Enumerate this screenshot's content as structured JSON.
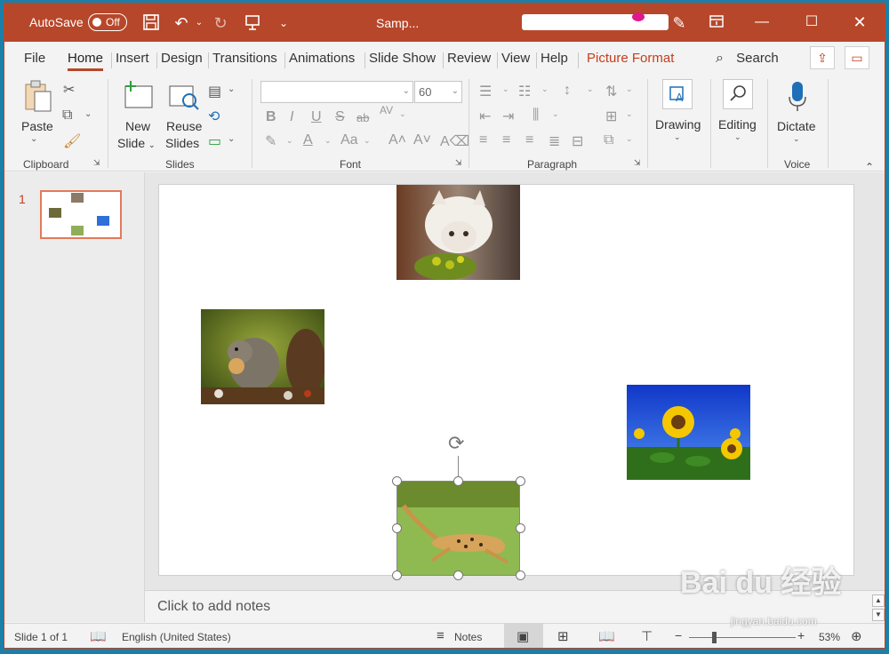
{
  "window": {
    "autosave_label": "AutoSave",
    "autosave_state": "Off",
    "doc_title": "Samp..."
  },
  "tabs": [
    {
      "label": "File"
    },
    {
      "label": "Home"
    },
    {
      "label": "Insert"
    },
    {
      "label": "Design"
    },
    {
      "label": "Transitions"
    },
    {
      "label": "Animations"
    },
    {
      "label": "Slide Show"
    },
    {
      "label": "Review"
    },
    {
      "label": "View"
    },
    {
      "label": "Help"
    },
    {
      "label": "Picture Format"
    }
  ],
  "search_label": "Search",
  "ribbon": {
    "paste": "Paste",
    "new_slide": "New",
    "new_slide_2": "Slide",
    "reuse": "Reuse",
    "reuse_2": "Slides",
    "font_size": "60",
    "drawing": "Drawing",
    "editing": "Editing",
    "dictate": "Dictate",
    "groups": {
      "clipboard": "Clipboard",
      "slides": "Slides",
      "font": "Font",
      "paragraph": "Paragraph",
      "voice": "Voice"
    }
  },
  "thumbnail_number": "1",
  "notes_placeholder": "Click to add notes",
  "status": {
    "slide_info": "Slide 1 of 1",
    "language": "English (United States)",
    "notes_label": "Notes",
    "zoom_minus": "−",
    "zoom_plus": "+",
    "zoom_value": "53%"
  },
  "watermark": {
    "main": "Bai du 经验",
    "sub": "jingyan.baidu.com"
  },
  "colors": {
    "accent": "#b7472a",
    "accent_text": "#c43e1c"
  }
}
